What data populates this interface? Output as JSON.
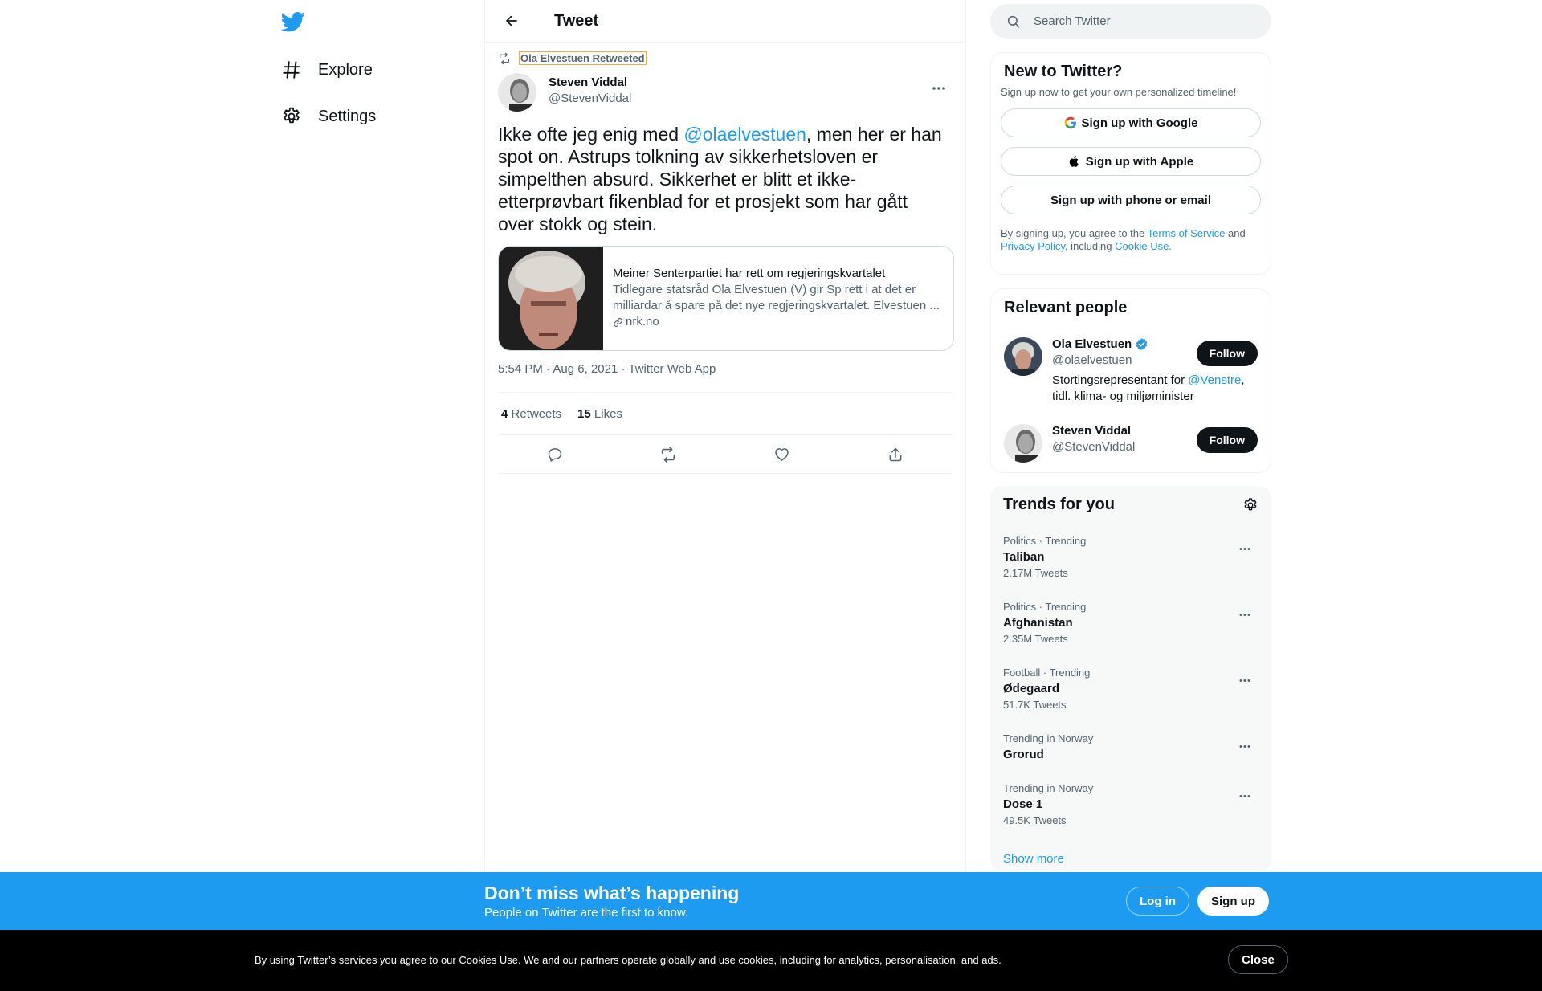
{
  "nav": {
    "items": [
      {
        "label": "Explore",
        "icon": "hash-icon"
      },
      {
        "label": "Settings",
        "icon": "gear-icon"
      }
    ]
  },
  "header": {
    "title": "Tweet"
  },
  "tweet": {
    "retweeted_by": "Ola Elvestuen Retweeted",
    "author_name": "Steven Viddal",
    "author_handle": "@StevenViddal",
    "text_before": "Ikke ofte jeg enig med ",
    "mention": "@olaelvestuen",
    "text_after": ", men her er han spot on. Astrups tolkning av sikkerhetsloven er simpelthen absurd. Sikkerhet er blitt et ikke-etterprøvbart fikenblad for et prosjekt som har gått over stokk og stein.",
    "card": {
      "title": "Meiner Senterpartiet har rett om regjeringskvartalet",
      "description": "Tidlegare statsråd Ola Elvestuen (V) gir Sp rett i at det er milliardar å spare på det nye regjeringskvartalet. Elvestuen ...",
      "domain": "nrk.no"
    },
    "time": "5:54 PM",
    "date": "Aug 6, 2021",
    "source": "Twitter Web App",
    "sep": "·",
    "retweets_count": "4",
    "retweets_label": "Retweets",
    "likes_count": "15",
    "likes_label": "Likes"
  },
  "search": {
    "placeholder": "Search Twitter"
  },
  "signup_panel": {
    "title": "New to Twitter?",
    "subtitle": "Sign up now to get your own personalized timeline!",
    "google": "Sign up with Google",
    "apple": "Sign up with Apple",
    "phone": "Sign up with phone or email",
    "legal_1": "By signing up, you agree to the ",
    "tos": "Terms of Service",
    "legal_2": " and ",
    "privacy": "Privacy Policy",
    "legal_3": ", including ",
    "cookie": "Cookie Use."
  },
  "people_panel": {
    "title": "Relevant people",
    "people": [
      {
        "name": "Ola Elvestuen",
        "handle": "@olaelvestuen",
        "bio_1": "Stortingsrepresentant for ",
        "bio_mention": "@Venstre",
        "bio_2": ", tidl. klima- og miljøminister",
        "follow": "Follow",
        "verified": true
      },
      {
        "name": "Steven Viddal",
        "handle": "@StevenViddal",
        "follow": "Follow"
      }
    ]
  },
  "trends_panel": {
    "title": "Trends for you",
    "trends": [
      {
        "category": "Politics · Trending",
        "name": "Taliban",
        "count": "2.17M Tweets"
      },
      {
        "category": "Politics · Trending",
        "name": "Afghanistan",
        "count": "2.35M Tweets"
      },
      {
        "category": "Football · Trending",
        "name": "Ødegaard",
        "count": "51.7K Tweets"
      },
      {
        "category": "Trending in Norway",
        "name": "Grorud",
        "count": ""
      },
      {
        "category": "Trending in Norway",
        "name": "Dose 1",
        "count": "49.5K Tweets"
      }
    ],
    "show_more": "Show more"
  },
  "bottom_bar": {
    "title": "Don’t miss what’s happening",
    "subtitle": "People on Twitter are the first to know.",
    "login": "Log in",
    "signup": "Sign up"
  },
  "cookie_bar": {
    "text": "By using Twitter’s services you agree to our Cookies Use. We and our partners operate globally and use cookies, including for analytics, personalisation, and ads.",
    "close": "Close"
  },
  "colors": {
    "accent": "#1d9bf0",
    "text": "#0f1419",
    "muted": "#536471"
  }
}
